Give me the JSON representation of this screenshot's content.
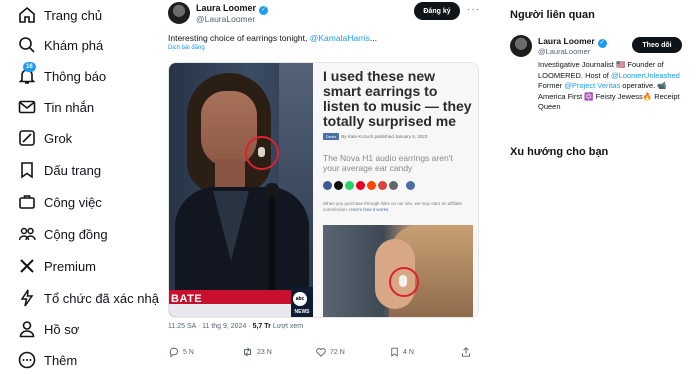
{
  "nav": {
    "items": [
      {
        "label": "Trang chủ",
        "icon": "home-icon"
      },
      {
        "label": "Khám phá",
        "icon": "search-icon"
      },
      {
        "label": "Thông báo",
        "icon": "bell-icon",
        "badge": "16"
      },
      {
        "label": "Tin nhắn",
        "icon": "mail-icon"
      },
      {
        "label": "Grok",
        "icon": "grok-icon"
      },
      {
        "label": "Dấu trang",
        "icon": "bookmark-icon"
      },
      {
        "label": "Công việc",
        "icon": "briefcase-icon"
      },
      {
        "label": "Cộng đồng",
        "icon": "people-icon"
      },
      {
        "label": "Premium",
        "icon": "x-logo-icon"
      },
      {
        "label": "Tổ chức đã xác nhậ",
        "icon": "lightning-icon"
      },
      {
        "label": "Hồ sơ",
        "icon": "person-icon"
      },
      {
        "label": "Thêm",
        "icon": "more-circle-icon"
      }
    ]
  },
  "post": {
    "author_name": "Laura Loomer",
    "handle": "@LauraLoomer",
    "follow_label": "Đăng ký",
    "text_before": "Interesting choice of earrings tonight, ",
    "mention": "@KamalaHarris",
    "text_after": "...",
    "translate_label": "Dịch bài đăng",
    "media": {
      "tv_caption": "BATE",
      "news_logo": "abc",
      "news_word": "NEWS",
      "article_title": "I used these new smart earrings to listen to music — they totally surprised me",
      "tag": "Deals",
      "byline": "By Kate Kozuch published January 5, 2023",
      "subtitle": "The Nova H1 audio earrings aren't your average ear candy",
      "disclaimer": "When you purchase through links on our site, we may earn an affiliate commission. ",
      "disclaimer_link": "Here's how it works."
    },
    "timestamp": "11:25 SA · 11 thg 9, 2024 · ",
    "views": "5,7 Tr",
    "views_label": " Lượt xem",
    "actions": {
      "replies": "5 N",
      "reposts": "23 N",
      "likes": "72 N",
      "bookmarks": "4 N"
    }
  },
  "right": {
    "related_title": "Người liên quan",
    "name": "Laura Loomer",
    "handle": "@LauraLoomer",
    "follow_label": "Theo dõi",
    "bio_1": "Investigative Journalist 🇺🇸 Founder of LOOMERED. Host of ",
    "bio_link_1": "@LoomerUnleashed",
    "bio_2": " Former ",
    "bio_link_2": "@Project Veritas",
    "bio_3": " operative. 📹 America First ✡️ Feisty Jewess🔥 Receipt Queen",
    "trends_title": "Xu hướng cho bạn"
  }
}
